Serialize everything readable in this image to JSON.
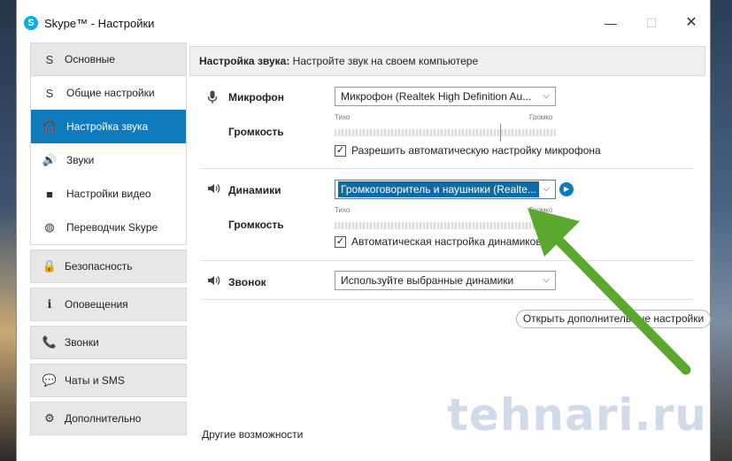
{
  "window": {
    "title": "Skype™ - Настройки",
    "app_icon_letter": "S",
    "controls": {
      "minimize": "—",
      "maximize": "☐",
      "close": "✕"
    }
  },
  "sidebar": {
    "groups": [
      {
        "label": "Основные",
        "icon": "skype-icon",
        "glyph": "S",
        "expanded": true,
        "items": [
          {
            "label": "Общие настройки",
            "icon": "skype-icon",
            "glyph": "S",
            "active": false
          },
          {
            "label": "Настройка звука",
            "icon": "headset-icon",
            "glyph": "🎧",
            "active": true
          },
          {
            "label": "Звуки",
            "icon": "speaker-icon",
            "glyph": "🔊",
            "active": false
          },
          {
            "label": "Настройки видео",
            "icon": "video-camera-icon",
            "glyph": "■",
            "active": false
          },
          {
            "label": "Переводчик Skype",
            "icon": "globe-icon",
            "glyph": "◍",
            "active": false
          }
        ]
      },
      {
        "label": "Безопасность",
        "icon": "lock-icon",
        "glyph": "🔒"
      },
      {
        "label": "Оповещения",
        "icon": "info-icon",
        "glyph": "ℹ"
      },
      {
        "label": "Звонки",
        "icon": "phone-icon",
        "glyph": "📞"
      },
      {
        "label": "Чаты и SMS",
        "icon": "chat-icon",
        "glyph": "💬"
      },
      {
        "label": "Дополнительно",
        "icon": "gear-icon",
        "glyph": "⚙"
      }
    ]
  },
  "header": {
    "title_bold": "Настройка звука:",
    "title_rest": " Настройте звук на своем компьютере"
  },
  "microphone": {
    "label": "Микрофон",
    "icon": "microphone-icon",
    "device": "Микрофон (Realtek High Definition Au...",
    "volume_label": "Громкость",
    "low": "Тихо",
    "high": "Громко",
    "level": 0.75,
    "auto_label": "Разрешить автоматическую настройку микрофона",
    "auto_checked": "✓"
  },
  "speakers": {
    "label": "Динамики",
    "icon": "speaker-icon",
    "device": "Громкоговоритель и наушники (Realte...",
    "volume_label": "Громкость",
    "low": "Тихо",
    "high": "Громко",
    "level": 1.0,
    "auto_label": "Автоматическая настройка динамиков",
    "auto_checked": "✓",
    "play_glyph": "▶"
  },
  "ringer": {
    "label": "Звонок",
    "icon": "speaker-icon",
    "device": "Используйте выбранные динамики"
  },
  "advanced_button": "Открыть дополнительные настройки",
  "other_features": "Другие возможности",
  "watermark": "tehnari.ru",
  "annotation_color": "#5aa82e",
  "accent_color": "#0f7bbf"
}
